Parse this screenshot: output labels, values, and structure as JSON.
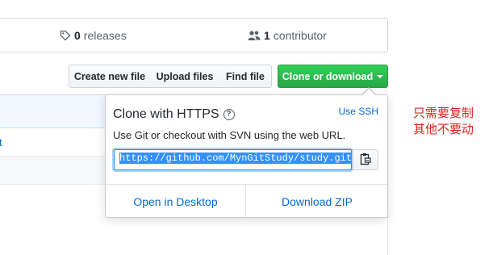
{
  "summary": {
    "releases_count": "0",
    "releases_label": "releases",
    "contributors_count": "1",
    "contributors_label": "contributor"
  },
  "toolbar": {
    "create_new_file": "Create new file",
    "upload_files": "Upload files",
    "find_file": "Find file",
    "clone_or_download": "Clone or download"
  },
  "file_list": {
    "partial_link": "t"
  },
  "clone_popup": {
    "title": "Clone with HTTPS",
    "help_glyph": "?",
    "use_ssh": "Use SSH",
    "description": "Use Git or checkout with SVN using the web URL.",
    "clone_url": "https://github.com/MynGitStudy/study.git",
    "open_in_desktop": "Open in Desktop",
    "download_zip": "Download ZIP"
  },
  "annotation": {
    "line1": "只需要复制",
    "line2": "其他不要动"
  },
  "colors": {
    "clone_button": "#28a745",
    "link": "#0366d6",
    "annotation": "#e0201b",
    "selection": "#3390ff"
  },
  "icons": [
    "tag-icon",
    "people-icon",
    "caret-down-icon",
    "help-icon",
    "clipboard-icon"
  ]
}
